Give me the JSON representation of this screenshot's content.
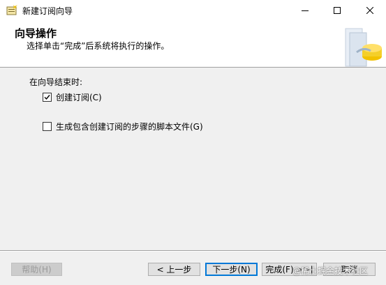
{
  "window": {
    "title": "新建订阅向导"
  },
  "header": {
    "title": "向导操作",
    "subtitle": "选择单击“完成”后系统将执行的操作。"
  },
  "body": {
    "label": "在向导结束时:",
    "options": [
      {
        "label": "创建订阅(C)",
        "checked": true
      },
      {
        "label": "生成包含创建订阅的步骤的脚本文件(G)",
        "checked": false
      }
    ]
  },
  "buttons": {
    "help": "帮助(H)",
    "prev": "< 上一步",
    "next": "下一步(N)",
    "finish": "完成(F) >>|",
    "cancel": "取消"
  },
  "watermark": {
    "text": "@稀土掘金技术社区"
  },
  "colors": {
    "accent": "#0078d7",
    "header_bg": "#ffffff",
    "dialog_bg": "#f0f0f0"
  }
}
